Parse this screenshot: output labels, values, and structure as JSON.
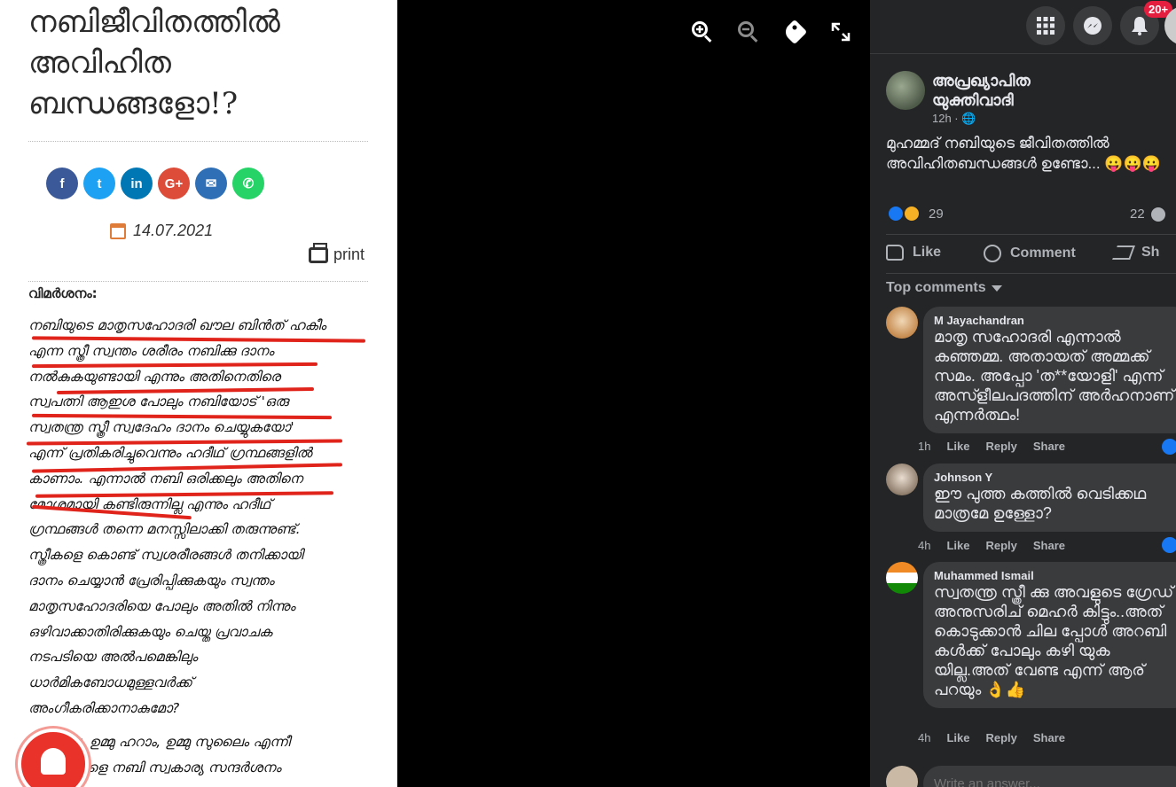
{
  "article": {
    "title_lines": [
      "നബിജീവിതത്തിൽ",
      "അവിഹിത",
      "ബന്ധങ്ങളോ!?"
    ],
    "share_icons": [
      {
        "icon": "facebook-icon",
        "glyph": "f",
        "color": "#3b5998"
      },
      {
        "icon": "twitter-icon",
        "glyph": "t",
        "color": "#1da1f2"
      },
      {
        "icon": "linkedin-icon",
        "glyph": "in",
        "color": "#0077b5"
      },
      {
        "icon": "google-plus-icon",
        "glyph": "G+",
        "color": "#dd4b39"
      },
      {
        "icon": "email-icon",
        "glyph": "✉",
        "color": "#2f6fb5"
      },
      {
        "icon": "whatsapp-icon",
        "glyph": "✆",
        "color": "#25d366"
      }
    ],
    "date": "14.07.2021",
    "print_label": "print",
    "critique_label": "വിമർശനം:",
    "body_lines": [
      "നബിയുടെ മാതൃസഹോദരി ഖൗല ബിൻത് ഹകീം",
      "എന്ന സ്ത്രീ സ്വന്തം ശരീരം നബിക്കു ദാനം",
      "നൽകുകയുണ്ടായി എന്നും അതിനെതിരെ",
      "സ്വപത്നി ആഇശ പോലും നബിയോട് 'ഒരു",
      "സ്വതന്ത്ര സ്ത്രീ സ്വദേഹം ദാനം ചെയ്യുകയോ'",
      "എന്ന് പ്രതികരിച്ചുവെന്നും ഹദീഥ് ഗ്രന്ഥങ്ങളിൽ",
      "കാണാം. എന്നാൽ നബി ഒരിക്കലും അതിനെ",
      "മോശമായി കണ്ടിരുന്നില്ല എന്നും ഹദീഥ്",
      "ഗ്രന്ഥങ്ങൾ തന്നെ മനസ്സിലാക്കി തരുന്നുണ്ട്.",
      "സ്ത്രീകളെ കൊണ്ട് സ്വശരീരങ്ങൾ തനിക്കായി",
      "ദാനം ചെയ്യാൻ പ്രേരിപ്പിക്കുകയും സ്വന്തം",
      "മാതൃസഹോദരിയെ പോലും അതിൽ നിന്നും",
      "ഒഴിവാക്കാതിരിക്കുകയും ചെയ്ത പ്രവാചക",
      "നടപടിയെ അൽപമെങ്കിലും",
      "ധാർമികബോധമുള്ളവർക്ക്",
      "അംഗീകരിക്കാനാകുമോ?"
    ],
    "body2_lines": [
      "മല്ല, ഉമ്മു ഹറാം, ഉമ്മു സുലൈം എന്നീ",
      "ികളെ നബി സ്വകാര്യ സന്ദർശനം"
    ]
  },
  "viewer_tools": [
    "zoom-in-icon",
    "zoom-out-icon",
    "tag-icon",
    "fullscreen-icon"
  ],
  "facebook": {
    "notification_count": "20+",
    "post": {
      "author": "അപ്രഖ്യാപിത യുക്തിവാദി",
      "time": "12h · ",
      "globe": "🌐",
      "text": "മുഹമ്മദ് നബിയുടെ ജീവിതത്തിൽ അവിഹിതബന്ധങ്ങൾ ഉണ്ടോ... 😛😛😛",
      "reaction_count": "29",
      "comment_count": "22"
    },
    "actions": {
      "like": "Like",
      "comment": "Comment",
      "share": "Sh"
    },
    "top_comments_label": "Top comments",
    "comments": [
      {
        "name": "M Jayachandran",
        "text": "മാതൃ സഹോദരി എന്നാൽ കഞ്ഞമ്മ. അതായത് അമ്മക്ക് സമം. അപ്പോ 'ത**യോളി' എന്ന് അസ്ളീലപദത്തിന് അർഹനാണ് എന്നർത്ഥം!",
        "time": "1h",
        "like": "Like",
        "reply": "Reply",
        "share": "Share"
      },
      {
        "name": "Johnson Y",
        "text": "ഈ പുത്ത കത്തിൽ വെടിക്കഥ മാത്രമേ ഉള്ളോ?",
        "time": "4h",
        "like": "Like",
        "reply": "Reply",
        "share": "Share"
      },
      {
        "name": "Muhammed Ismail",
        "text": "സ്വതന്ത്ര സ്ത്രീ ക്കു അവളുടെ ഗ്രേഡ് അനുസരിച് മെഹർ കിട്ടും..അത് കൊടുക്കാൻ ചില പ്പോൾ അറബി കൾക്ക് പോലും കഴി യുക യില്ല.അത് വേണ്ട എന്ന് ആര് പറയും 👌👍",
        "time": "4h",
        "like": "Like",
        "reply": "Reply",
        "share": "Share"
      }
    ],
    "answer_placeholder": "Write an answer..."
  },
  "colors": {
    "fb_bg": "#242526",
    "fb_bubble": "#3a3b3c",
    "fb_blue": "#1877f2",
    "red_underline": "#e0231b"
  }
}
